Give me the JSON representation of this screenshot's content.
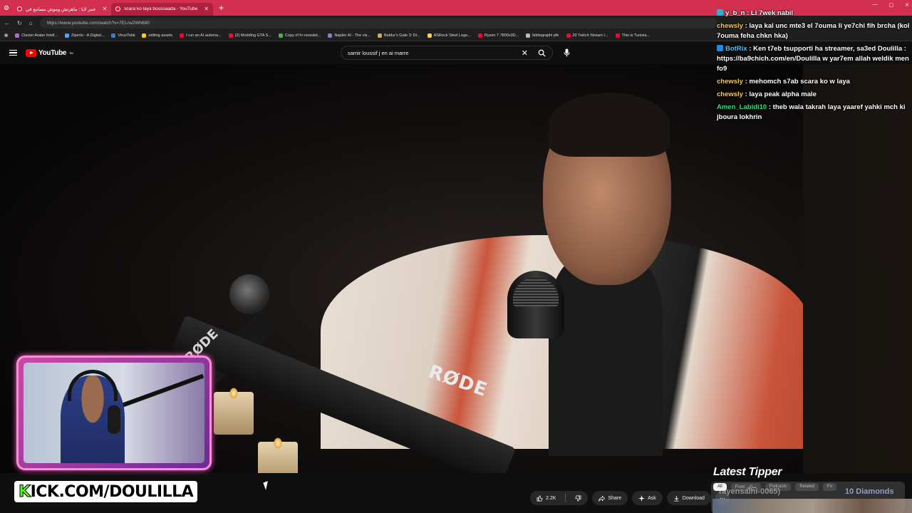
{
  "browser": {
    "tabs": [
      {
        "title": "عمر لايا : ماهزتش وموش مسامع في"
      },
      {
        "title": "scara ko laya boussaada - YouTube"
      }
    ],
    "new_tab": "+",
    "url": "https://www.youtube.com/watch?v=7ELrw2Wh690",
    "bookmarks": [
      {
        "label": "Clavier Arabe Intell...",
        "color": "#b06cd6"
      },
      {
        "label": "Ziperto - A Digital...",
        "color": "#4da3ff"
      },
      {
        "label": "VirusTotal",
        "color": "#3a7bd5"
      },
      {
        "label": "editing assets",
        "color": "#ffcc00"
      },
      {
        "label": "I run an AI automa...",
        "color": "#ff0033"
      },
      {
        "label": "(2) Modding GTA S...",
        "color": "#ff0033"
      },
      {
        "label": "Copy of hr-newslet...",
        "color": "#4caf50"
      },
      {
        "label": "Napkin AI - The vis...",
        "color": "#9575cd"
      },
      {
        "label": "Baldur's Gate 3: Di...",
        "color": "#cfa86a"
      },
      {
        "label": "ASRock Steel Lege...",
        "color": "#ffd54f"
      },
      {
        "label": "Ryzen 7 7800x3D...",
        "color": "#ff0033"
      },
      {
        "label": "bibliographi pfe",
        "color": "#bbbbbb"
      },
      {
        "label": "20 Twitch Stream I...",
        "color": "#ff0033"
      },
      {
        "label": "This is Tunisia...",
        "color": "#ff0033"
      }
    ]
  },
  "youtube": {
    "logo": "YouTube",
    "logo_tm": "TM",
    "search_value": "samir loussif j en ai marre",
    "actions": {
      "likes": "2.2K",
      "share": "Share",
      "ask": "Ask",
      "download": "Download"
    }
  },
  "chat": {
    "messages": [
      {
        "user": "y_b_n",
        "text": "Li 7wek nabil",
        "user_color": "#ffffff"
      },
      {
        "user": "chewsly",
        "text": "laya kal unc mte3 el 7ouma li ye7chi fih brcha (kol 7ouma feha chkn hka)",
        "user_color": "#f3c66b"
      },
      {
        "user": "BotRix",
        "text": "Ken t7eb tsupporti ha streamer, sa3ed Doulilla : https://ba9chich.com/en/Doulilla w yar7em allah weldik men fo9",
        "user_color": "#4fc3f7"
      },
      {
        "user": "chewsly",
        "text": "mehomch s7ab scara ko w laya",
        "user_color": "#f3c66b"
      },
      {
        "user": "chewsly",
        "text": "laya peak alpha male",
        "user_color": "#f3c66b"
      },
      {
        "user": "Amen_Labidi10",
        "text": "theb wala takrah laya yaaref yahki mch ki jboura lokhrin",
        "user_color": "#3fd97f"
      }
    ]
  },
  "overlay": {
    "kick_prefix": "K",
    "kick_rest": "ICK.COM/DOULILLA",
    "latest_tipper_title": "Latest Tipper",
    "tipper_name": "rayensalhi-0065)",
    "tipper_amount": "10 Diamonds",
    "chips": [
      "All",
      "From ساكن",
      "Podcasts",
      "Related",
      "Fo"
    ]
  },
  "video": {
    "mic_brand": "RØDE"
  }
}
